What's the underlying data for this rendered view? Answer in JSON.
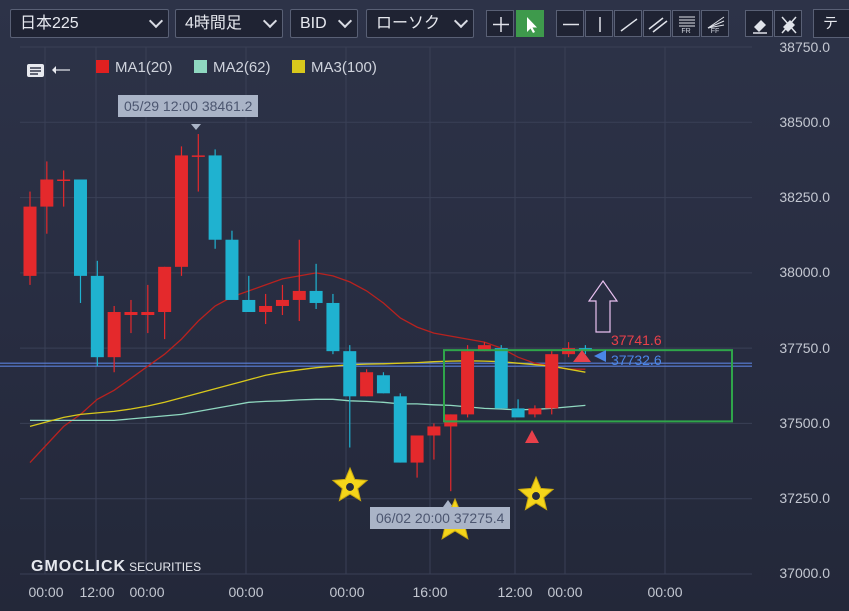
{
  "toolbar": {
    "symbol": "日本225",
    "timeframe": "4時間足",
    "price_type": "BID",
    "chart_style": "ローソク",
    "tools_label_fr": "FR",
    "tools_label_ff": "FF",
    "right_label": "テク"
  },
  "legend": {
    "ma1": {
      "label": "MA1(20)",
      "color": "#e02020"
    },
    "ma2": {
      "label": "MA2(62)",
      "color": "#8fd8c0"
    },
    "ma3": {
      "label": "MA3(100)",
      "color": "#d8c81c"
    }
  },
  "annotations": {
    "high_label": "05/29 12:00 38461.2",
    "low_label": "06/02 20:00 37275.4",
    "price_red": "37741.6",
    "price_blue": "37732.6"
  },
  "logo": {
    "main": "GMOCLICK",
    "sub": "SECURITIES"
  },
  "colors": {
    "up": "#e4292c",
    "down": "#1fb2d0",
    "grid": "#3a4056",
    "box": "#2fa54a"
  },
  "chart_data": {
    "type": "candlestick",
    "title": "",
    "ylim": [
      37000,
      38750
    ],
    "y_ticks": [
      "38750.0",
      "38500.0",
      "38250.0",
      "38000.0",
      "37750.0",
      "37500.0",
      "37250.0",
      "37000.0"
    ],
    "x_ticks": [
      "00:00",
      "12:00",
      "00:00",
      "00:00",
      "00:00",
      "16:00",
      "12:00",
      "00:00",
      "00:00"
    ],
    "candles": [
      {
        "o": 37990,
        "h": 38270,
        "l": 37960,
        "c": 38220
      },
      {
        "o": 38220,
        "h": 38370,
        "l": 38130,
        "c": 38310
      },
      {
        "o": 38310,
        "h": 38340,
        "l": 38220,
        "c": 38310
      },
      {
        "o": 38310,
        "h": 38310,
        "l": 37900,
        "c": 37990
      },
      {
        "o": 37990,
        "h": 38040,
        "l": 37690,
        "c": 37720
      },
      {
        "o": 37720,
        "h": 37890,
        "l": 37670,
        "c": 37870
      },
      {
        "o": 37860,
        "h": 37910,
        "l": 37800,
        "c": 37870
      },
      {
        "o": 37860,
        "h": 37960,
        "l": 37800,
        "c": 37870
      },
      {
        "o": 37870,
        "h": 38020,
        "l": 37780,
        "c": 38020
      },
      {
        "o": 38020,
        "h": 38420,
        "l": 37990,
        "c": 38390
      },
      {
        "o": 38390,
        "h": 38461,
        "l": 38270,
        "c": 38390
      },
      {
        "o": 38390,
        "h": 38410,
        "l": 38080,
        "c": 38110
      },
      {
        "o": 38110,
        "h": 38140,
        "l": 37930,
        "c": 37910
      },
      {
        "o": 37910,
        "h": 37990,
        "l": 37880,
        "c": 37870
      },
      {
        "o": 37870,
        "h": 37930,
        "l": 37830,
        "c": 37890
      },
      {
        "o": 37890,
        "h": 37960,
        "l": 37860,
        "c": 37910
      },
      {
        "o": 37910,
        "h": 38110,
        "l": 37840,
        "c": 37940
      },
      {
        "o": 37940,
        "h": 38030,
        "l": 37880,
        "c": 37900
      },
      {
        "o": 37900,
        "h": 37930,
        "l": 37730,
        "c": 37740
      },
      {
        "o": 37740,
        "h": 37760,
        "l": 37420,
        "c": 37590
      },
      {
        "o": 37590,
        "h": 37680,
        "l": 37590,
        "c": 37670
      },
      {
        "o": 37660,
        "h": 37670,
        "l": 37600,
        "c": 37600
      },
      {
        "o": 37590,
        "h": 37600,
        "l": 37370,
        "c": 37370
      },
      {
        "o": 37370,
        "h": 37450,
        "l": 37320,
        "c": 37460
      },
      {
        "o": 37460,
        "h": 37500,
        "l": 37380,
        "c": 37490
      },
      {
        "o": 37490,
        "h": 37530,
        "l": 37275,
        "c": 37530
      },
      {
        "o": 37530,
        "h": 37760,
        "l": 37520,
        "c": 37740
      },
      {
        "o": 37740,
        "h": 37770,
        "l": 37740,
        "c": 37760
      },
      {
        "o": 37750,
        "h": 37760,
        "l": 37550,
        "c": 37550
      },
      {
        "o": 37550,
        "h": 37580,
        "l": 37530,
        "c": 37520
      },
      {
        "o": 37530,
        "h": 37560,
        "l": 37520,
        "c": 37550
      },
      {
        "o": 37550,
        "h": 37740,
        "l": 37530,
        "c": 37730
      },
      {
        "o": 37730,
        "h": 37770,
        "l": 37720,
        "c": 37750
      },
      {
        "o": 37750,
        "h": 37760,
        "l": 37730,
        "c": 37740
      }
    ],
    "ma1": [
      37370,
      37430,
      37490,
      37530,
      37580,
      37610,
      37650,
      37690,
      37730,
      37780,
      37840,
      37890,
      37920,
      37940,
      37960,
      37980,
      37990,
      38000,
      37990,
      37970,
      37940,
      37900,
      37850,
      37820,
      37800,
      37790,
      37780,
      37770,
      37750,
      37720,
      37700,
      37690,
      37680,
      37680
    ],
    "ma2": [
      37510,
      37510,
      37510,
      37510,
      37510,
      37510,
      37515,
      37520,
      37525,
      37530,
      37540,
      37550,
      37560,
      37570,
      37573,
      37575,
      37578,
      37580,
      37580,
      37575,
      37573,
      37570,
      37565,
      37565,
      37562,
      37560,
      37555,
      37550,
      37548,
      37545,
      37547,
      37550,
      37555,
      37560
    ],
    "ma3": [
      37490,
      37505,
      37520,
      37530,
      37535,
      37540,
      37548,
      37558,
      37570,
      37585,
      37600,
      37615,
      37630,
      37645,
      37660,
      37670,
      37678,
      37685,
      37690,
      37695,
      37697,
      37698,
      37700,
      37702,
      37705,
      37707,
      37708,
      37707,
      37705,
      37700,
      37695,
      37690,
      37680,
      37670
    ],
    "horizontal_lines": [
      37700,
      37690
    ],
    "highlight_box": {
      "y_from": 37530,
      "y_to": 37740
    }
  }
}
